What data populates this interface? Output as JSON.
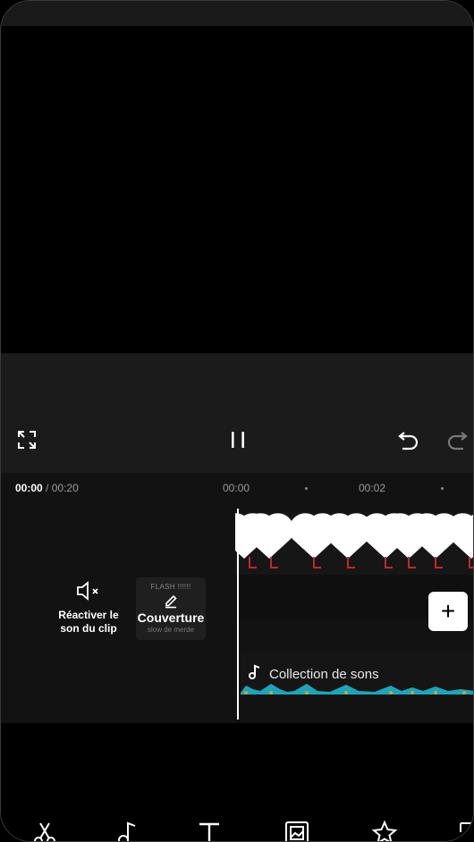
{
  "timeline": {
    "current_time": "00:00",
    "separator": " / ",
    "total_time": "00:20",
    "ruler": [
      "00:00",
      "00:02"
    ]
  },
  "mute": {
    "icon": "speaker-muted-icon",
    "label_line1": "Réactiver le",
    "label_line2": "son du clip"
  },
  "cover": {
    "tag": "FLASH !!!!!!",
    "icon": "pencil-icon",
    "label": "Couverture",
    "sublabel": "slow de merde"
  },
  "add_clip": {
    "label": "+"
  },
  "audio": {
    "icon": "music-note-icon",
    "title": "Collection de sons",
    "waveform_color": "#1fa3b8"
  },
  "controls": {
    "fullscreen_icon": "fullscreen-icon",
    "play_pause_icon": "pause-icon",
    "undo_icon": "undo-icon",
    "redo_icon": "redo-icon"
  },
  "toolbar": {
    "tools": [
      "scissors-icon",
      "music-note-icon",
      "text-icon",
      "image-overlay-icon",
      "effects-star-icon",
      "aspect-ratio-icon"
    ]
  },
  "colors": {
    "background": "#000000",
    "panel": "#1b1b1b",
    "timeline": "#121212",
    "accent_red": "#c0272d",
    "waveform": "#1fa3b8"
  }
}
